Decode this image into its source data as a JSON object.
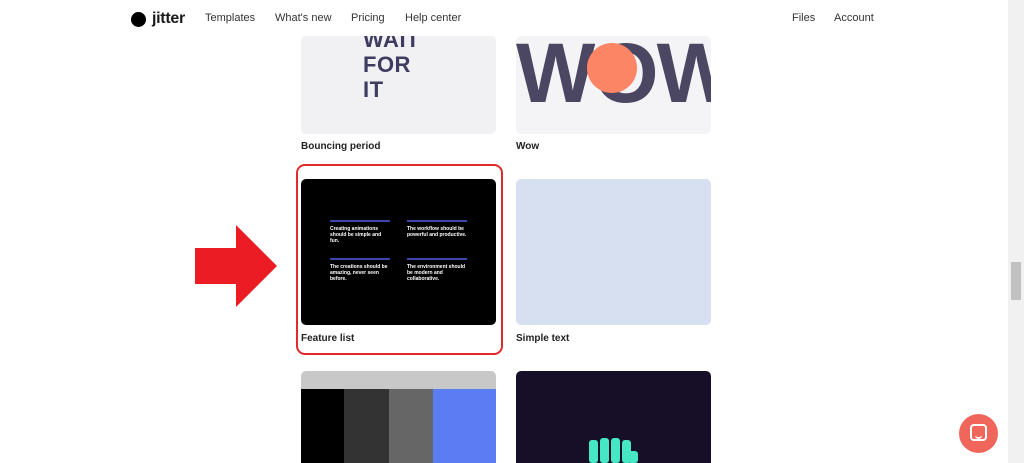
{
  "nav": {
    "logo": "jitter",
    "links": [
      "Templates",
      "What's new",
      "Pricing",
      "Help center"
    ],
    "right_links": [
      "Files",
      "Account"
    ]
  },
  "templates": [
    {
      "title": "Bouncing period",
      "art_text": [
        "WAIT",
        "FOR",
        "IT"
      ]
    },
    {
      "title": "Wow",
      "art_text": "WOW"
    },
    {
      "title": "Feature list",
      "features": [
        "Creating animations should be simple and fun.",
        "The workflow should be powerful and productive.",
        "The creations should be amazing, never seen before.",
        "The environment should be modern and collaborative."
      ]
    },
    {
      "title": "Simple text"
    }
  ],
  "colors": {
    "highlight": "#e02b2b",
    "arrow": "#ec1c24",
    "chat_button": "#f0665a",
    "feature_bg": "#000000",
    "simple_text_bg": "#d7e0f1",
    "wow_dot": "#fb8565",
    "hand": "#45e8c3"
  },
  "icons": {
    "arrow": "right-arrow-icon",
    "chat": "chat-icon",
    "logo": "jitter-logo-icon"
  }
}
